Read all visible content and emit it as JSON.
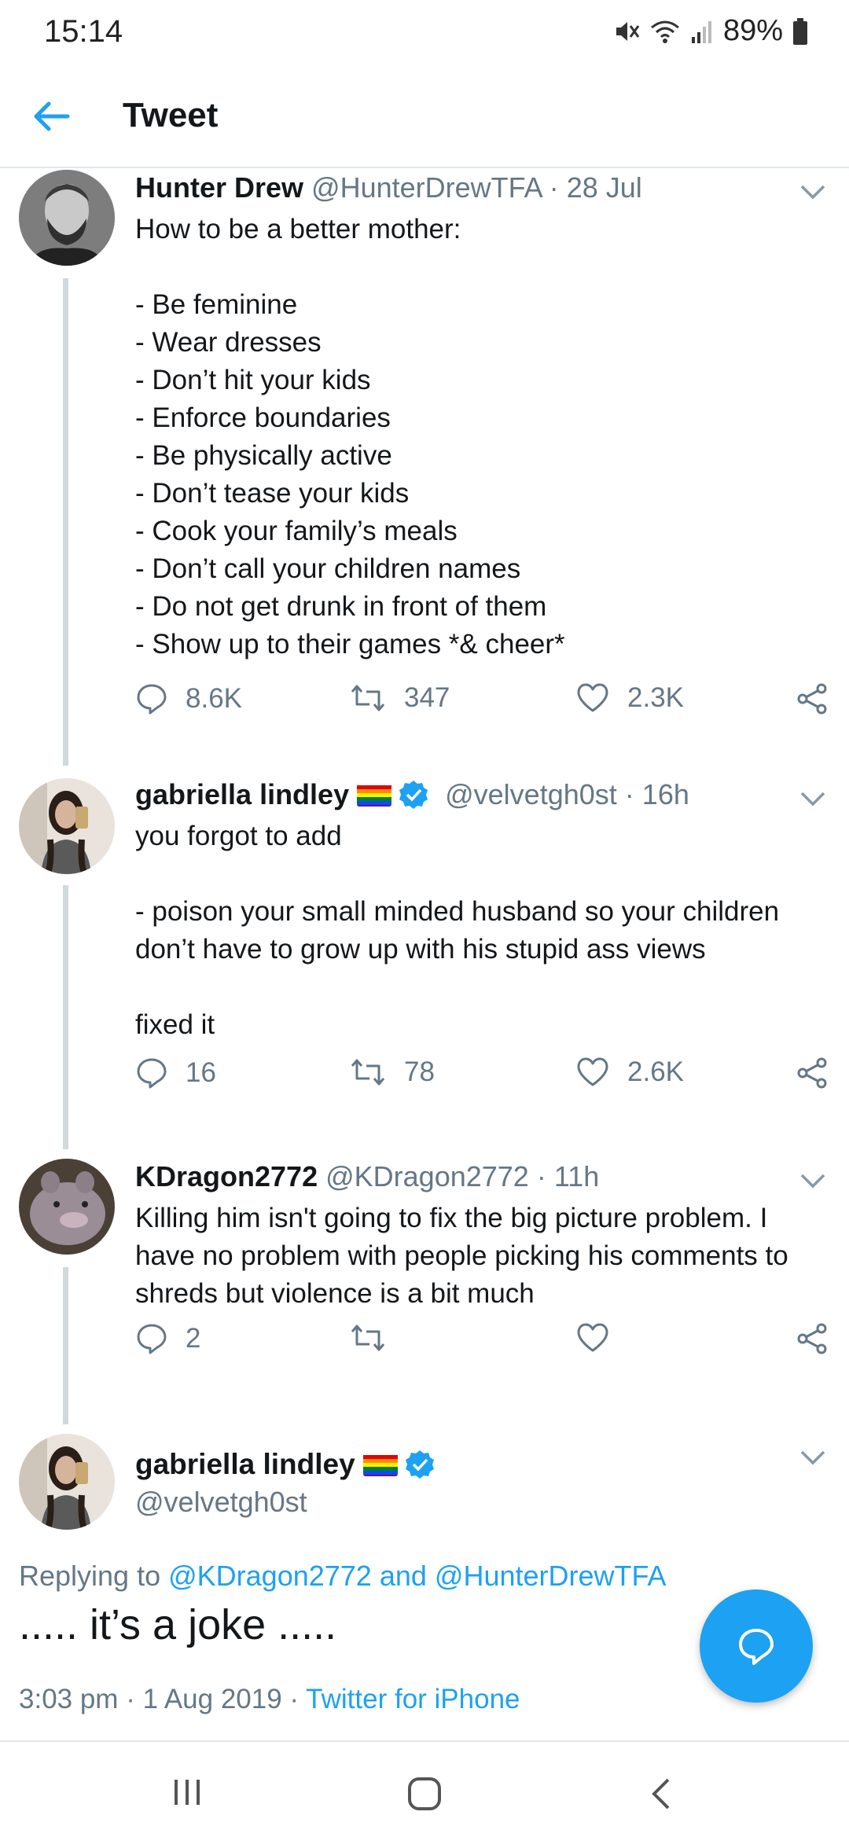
{
  "status_bar": {
    "time": "15:14",
    "battery": "89%"
  },
  "header": {
    "title": "Tweet"
  },
  "tweets": [
    {
      "name": "Hunter Drew",
      "handle": "@HunterDrewTFA",
      "time": "28 Jul",
      "lines": [
        "How to be a better mother:",
        "",
        "- Be feminine",
        "- Wear dresses",
        "- Don’t hit your kids",
        "- Enforce boundaries",
        "- Be physically active",
        "- Don’t tease your kids",
        "- Cook your family’s meals",
        "- Don’t call your children names",
        "- Do not get drunk in front of them",
        "- Show up to their games *& cheer*"
      ],
      "replies": "8.6K",
      "retweets": "347",
      "likes": "2.3K"
    },
    {
      "name": "gabriella lindley",
      "handle": "@velvetgh0st",
      "time": "16h",
      "lines": [
        "you forgot to add",
        "",
        "- poison your small minded husband so your children",
        "don’t have to grow up with his stupid ass views",
        "",
        "fixed it"
      ],
      "replies": "16",
      "retweets": "78",
      "likes": "2.6K"
    },
    {
      "name": "KDragon2772",
      "handle": "@KDragon2772",
      "time": "11h",
      "lines": [
        "Killing him isn't going to fix the big picture problem. I",
        "have no problem with people picking his comments to",
        "shreds but violence is a bit much"
      ],
      "replies": "2",
      "retweets": "",
      "likes": ""
    }
  ],
  "focused_tweet": {
    "name": "gabriella lindley",
    "handle": "@velvetgh0st",
    "replying_prefix": "Replying to ",
    "reply_to_1": "@KDragon2772",
    "reply_and": " and ",
    "reply_to_2": "@HunterDrewTFA",
    "text": "..... it’s a joke .....",
    "timestamp": "3:03 pm · 1 Aug 2019 · ",
    "source": "Twitter for iPhone"
  },
  "colors": {
    "accent": "#1da1f2",
    "secondary_text": "#657786",
    "thread_line": "#cfd9de",
    "verified": "#1da1f2"
  },
  "icons": {
    "back": "arrow-left-icon",
    "reply": "speech-bubble-icon",
    "retweet": "retweet-icon",
    "like": "heart-icon",
    "share": "share-icon",
    "compose": "compose-reply-icon",
    "verified": "verified-badge-icon",
    "flag": "rainbow-flag-icon"
  }
}
